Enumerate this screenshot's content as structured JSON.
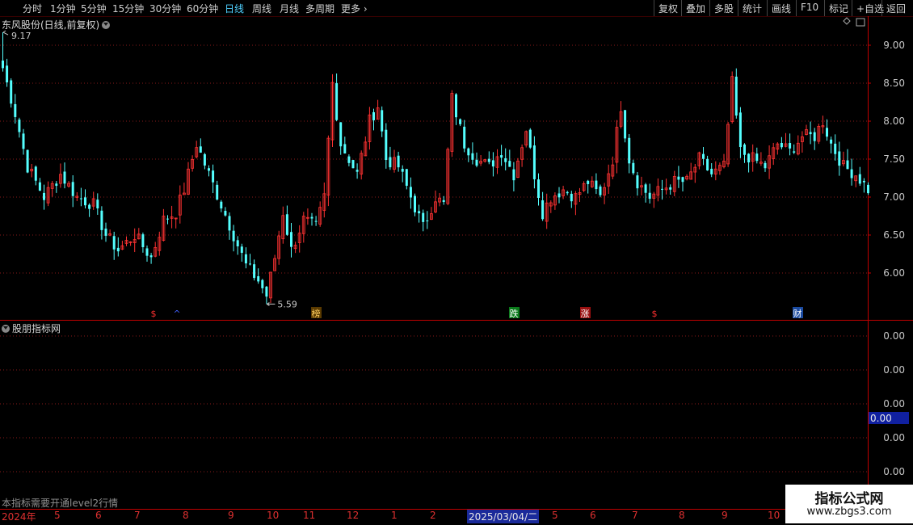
{
  "toolbar": {
    "periods": [
      "分时",
      "1分钟",
      "5分钟",
      "15分钟",
      "30分钟",
      "60分钟",
      "日线",
      "周线",
      "月线",
      "多周期",
      "更多"
    ],
    "active_period": "日线",
    "actions": [
      "复权",
      "叠加",
      "多股",
      "统计",
      "画线",
      "F10",
      "标记",
      "+自选",
      "返回"
    ]
  },
  "main_chart": {
    "title": "东风股份(日线,前复权)",
    "high_label": "9.17",
    "low_label": "5.59",
    "signals": [
      {
        "text": "$",
        "color": "#ff3030",
        "bg": "#000000"
      },
      {
        "text": "^",
        "color": "#4060ff",
        "bg": "#000000"
      },
      {
        "text": "榜",
        "color": "#ffd060",
        "bg": "#5a3a00"
      },
      {
        "text": "跌",
        "color": "#ffffff",
        "bg": "#0a7a1a"
      },
      {
        "text": "涨",
        "color": "#ffffff",
        "bg": "#9a1010"
      },
      {
        "text": "$",
        "color": "#ff3030",
        "bg": "#000000"
      },
      {
        "text": "财",
        "color": "#ffffff",
        "bg": "#1a4aa0"
      }
    ]
  },
  "chart_data": {
    "type": "candlestick",
    "title": "东风股份(日线,前复权)",
    "y_ticks": [
      "9.00",
      "8.50",
      "8.00",
      "7.50",
      "7.00",
      "6.50",
      "6.00"
    ],
    "y_range": [
      5.5,
      9.4
    ],
    "period_high": 9.17,
    "period_low": 5.59,
    "anchors": [
      [
        0,
        8.7
      ],
      [
        3,
        8.1
      ],
      [
        6,
        7.4
      ],
      [
        10,
        7.0
      ],
      [
        14,
        7.3
      ],
      [
        18,
        7.0
      ],
      [
        22,
        6.9
      ],
      [
        25,
        6.5
      ],
      [
        28,
        6.3
      ],
      [
        32,
        6.5
      ],
      [
        36,
        6.2
      ],
      [
        39,
        6.7
      ],
      [
        42,
        6.8
      ],
      [
        44,
        7.1
      ],
      [
        47,
        7.7
      ],
      [
        50,
        7.3
      ],
      [
        53,
        6.9
      ],
      [
        56,
        6.5
      ],
      [
        59,
        6.1
      ],
      [
        62,
        5.9
      ],
      [
        64,
        5.7
      ],
      [
        66,
        6.2
      ],
      [
        68,
        6.8
      ],
      [
        70,
        6.3
      ],
      [
        73,
        6.7
      ],
      [
        76,
        6.6
      ],
      [
        78,
        7.0
      ],
      [
        80,
        8.5
      ],
      [
        82,
        7.7
      ],
      [
        84,
        7.5
      ],
      [
        86,
        7.3
      ],
      [
        89,
        8.0
      ],
      [
        91,
        8.2
      ],
      [
        93,
        7.5
      ],
      [
        96,
        7.4
      ],
      [
        99,
        7.0
      ],
      [
        102,
        6.6
      ],
      [
        105,
        7.0
      ],
      [
        107,
        6.9
      ],
      [
        109,
        8.3
      ],
      [
        112,
        7.7
      ],
      [
        115,
        7.5
      ],
      [
        118,
        7.4
      ],
      [
        121,
        7.6
      ],
      [
        124,
        7.3
      ],
      [
        127,
        7.9
      ],
      [
        129,
        7.3
      ],
      [
        131,
        6.8
      ],
      [
        133,
        7.0
      ],
      [
        136,
        7.1
      ],
      [
        139,
        7.0
      ],
      [
        142,
        7.2
      ],
      [
        145,
        7.0
      ],
      [
        148,
        7.5
      ],
      [
        150,
        8.2
      ],
      [
        152,
        7.5
      ],
      [
        154,
        7.2
      ],
      [
        157,
        7.0
      ],
      [
        160,
        7.1
      ],
      [
        163,
        7.2
      ],
      [
        166,
        7.2
      ],
      [
        169,
        7.5
      ],
      [
        172,
        7.3
      ],
      [
        175,
        7.4
      ],
      [
        177,
        8.5
      ],
      [
        179,
        7.6
      ],
      [
        182,
        7.5
      ],
      [
        185,
        7.4
      ],
      [
        188,
        7.7
      ],
      [
        191,
        7.6
      ],
      [
        194,
        7.8
      ],
      [
        197,
        7.8
      ],
      [
        199,
        8.0
      ],
      [
        201,
        7.7
      ],
      [
        204,
        7.4
      ],
      [
        207,
        7.3
      ],
      [
        210,
        7.1
      ]
    ],
    "indicator": {
      "name": "股朋指标网",
      "y_ticks": [
        "0.00",
        "0.00",
        "0.00",
        "0.00",
        "0.00"
      ],
      "current_value": "0.00"
    },
    "x_labels": [
      "2024年",
      "5",
      "6",
      "7",
      "8",
      "9",
      "10",
      "11",
      "12",
      "1",
      "2",
      "2025/03/04/二",
      "5",
      "6",
      "7",
      "8",
      "9",
      "10"
    ]
  },
  "indicator_note": "本指标需要开通level2行情",
  "watermark": {
    "title": "指标公式网",
    "url": "www.zbgs3.com"
  },
  "colors": {
    "up": "#ff3232",
    "down": "#54ffff",
    "grid": "#8a1a1a",
    "axis": "#c00000",
    "label": "#c8c8c8"
  }
}
